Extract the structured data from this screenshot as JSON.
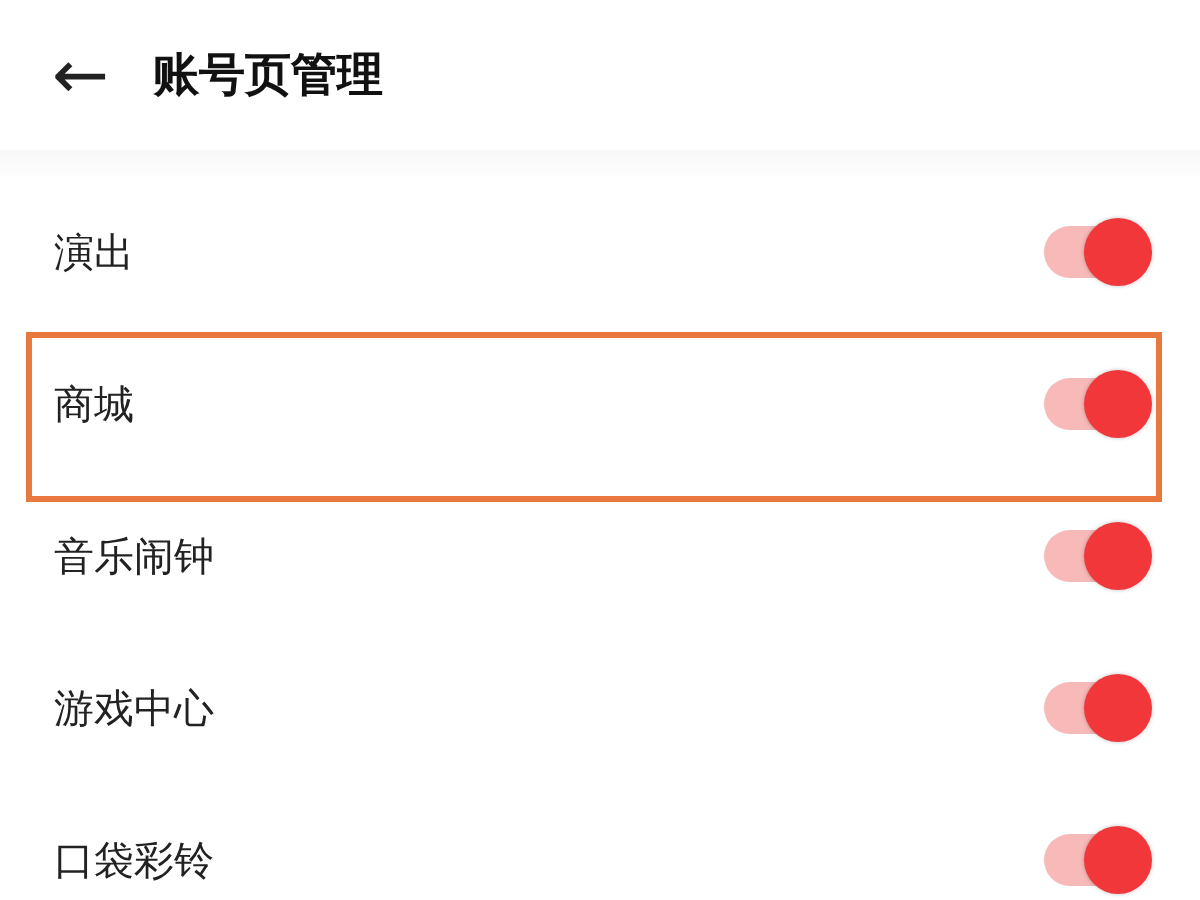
{
  "header": {
    "back": "←",
    "title": "账号页管理"
  },
  "items": [
    {
      "label": "演出",
      "on": true,
      "highlighted": false
    },
    {
      "label": "商城",
      "on": true,
      "highlighted": true
    },
    {
      "label": "音乐闹钟",
      "on": true,
      "highlighted": false
    },
    {
      "label": "游戏中心",
      "on": true,
      "highlighted": false
    },
    {
      "label": "口袋彩铃",
      "on": true,
      "highlighted": false
    }
  ]
}
